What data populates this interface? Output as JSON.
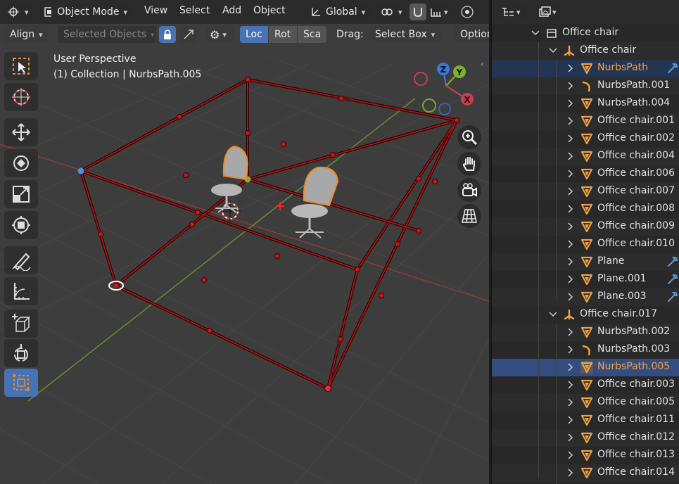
{
  "header": {
    "mode_label": "Object Mode",
    "menus": [
      "View",
      "Select",
      "Add",
      "Object"
    ],
    "transform_orientation": "Global"
  },
  "toolbar2": {
    "align_label": "Align",
    "selected_objects_label": "Selected Objects",
    "loc_label": "Loc",
    "rot_label": "Rot",
    "sca_label": "Sca",
    "drag_label": "Drag:",
    "select_box_label": "Select Box",
    "options_label": "Option"
  },
  "viewport": {
    "title": "User Perspective",
    "subtitle": "(1) Collection | NurbsPath.005",
    "gizmo": {
      "x": "X",
      "y": "Y",
      "z": "Z"
    }
  },
  "tools": [
    "select-box",
    "cursor",
    "move",
    "rotate",
    "scale",
    "transform",
    "annotate",
    "measure",
    "add-cube",
    "spin",
    "cage"
  ],
  "outliner": {
    "rows": [
      {
        "label": "Office chair",
        "icon": "collection",
        "depth": 0,
        "expanded": true
      },
      {
        "label": "Office chair",
        "icon": "empty",
        "depth": 1,
        "expanded": true
      },
      {
        "label": "NurbsPath",
        "icon": "mesh",
        "depth": 2,
        "state": "highlighted",
        "modifier": true
      },
      {
        "label": "NurbsPath.001",
        "icon": "curve",
        "depth": 2
      },
      {
        "label": "NurbsPath.004",
        "icon": "mesh",
        "depth": 2
      },
      {
        "label": "Office chair.001",
        "icon": "mesh",
        "depth": 2
      },
      {
        "label": "Office chair.002",
        "icon": "mesh",
        "depth": 2
      },
      {
        "label": "Office chair.004",
        "icon": "mesh",
        "depth": 2
      },
      {
        "label": "Office chair.006",
        "icon": "mesh",
        "depth": 2
      },
      {
        "label": "Office chair.007",
        "icon": "mesh",
        "depth": 2
      },
      {
        "label": "Office chair.008",
        "icon": "mesh",
        "depth": 2
      },
      {
        "label": "Office chair.009",
        "icon": "mesh",
        "depth": 2
      },
      {
        "label": "Office chair.010",
        "icon": "mesh",
        "depth": 2
      },
      {
        "label": "Plane",
        "icon": "mesh",
        "depth": 2,
        "modifier": true
      },
      {
        "label": "Plane.001",
        "icon": "mesh",
        "depth": 2,
        "modifier": true
      },
      {
        "label": "Plane.003",
        "icon": "mesh",
        "depth": 2,
        "modifier": true
      },
      {
        "label": "Office chair.017",
        "icon": "empty",
        "depth": 1,
        "expanded": true
      },
      {
        "label": "NurbsPath.002",
        "icon": "mesh",
        "depth": 2
      },
      {
        "label": "NurbsPath.003",
        "icon": "curve",
        "depth": 2
      },
      {
        "label": "NurbsPath.005",
        "icon": "mesh",
        "depth": 2,
        "state": "selected"
      },
      {
        "label": "Office chair.003",
        "icon": "mesh",
        "depth": 2
      },
      {
        "label": "Office chair.005",
        "icon": "mesh",
        "depth": 2
      },
      {
        "label": "Office chair.011",
        "icon": "mesh",
        "depth": 2
      },
      {
        "label": "Office chair.012",
        "icon": "mesh",
        "depth": 2
      },
      {
        "label": "Office chair.013",
        "icon": "mesh",
        "depth": 2
      },
      {
        "label": "Office chair.014",
        "icon": "mesh",
        "depth": 2
      }
    ]
  },
  "colors": {
    "accent": "#4772b3",
    "selected_orange": "#f5a043",
    "cage_red": "#d21414",
    "axis_red": "#d04a4a",
    "axis_green": "#7aa83a"
  }
}
